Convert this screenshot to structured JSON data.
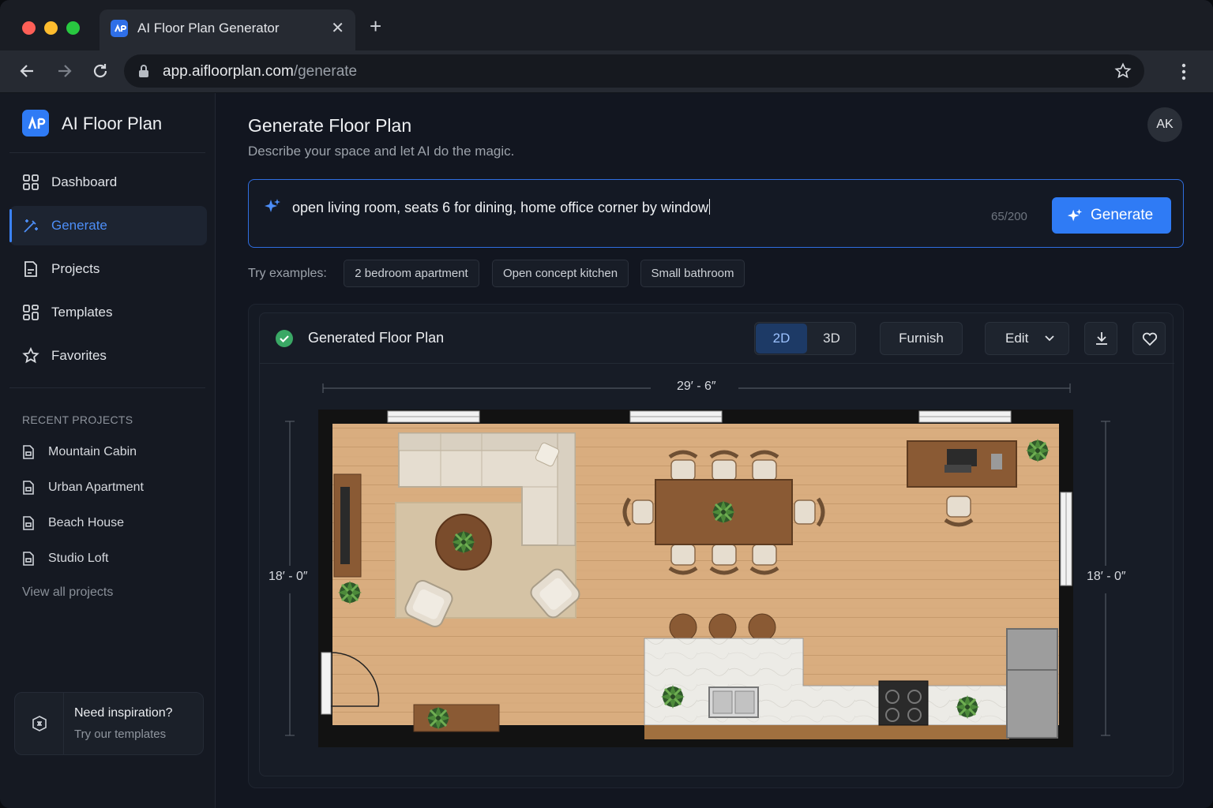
{
  "browser": {
    "tab_title": "AI Floor Plan Generator",
    "url_host": "app.aifloorplan.com",
    "url_path": "/generate"
  },
  "sidebar": {
    "brand": "AI Floor Plan",
    "nav": [
      {
        "label": "Dashboard",
        "icon": "grid-icon"
      },
      {
        "label": "Generate",
        "icon": "magic-wand-icon",
        "active": true
      },
      {
        "label": "Projects",
        "icon": "document-icon"
      },
      {
        "label": "Templates",
        "icon": "layout-icon"
      },
      {
        "label": "Favorites",
        "icon": "star-icon"
      }
    ],
    "recent_title": "RECENT PROJECTS",
    "recent": [
      "Mountain Cabin",
      "Urban Apartment",
      "Beach House",
      "Studio Loft"
    ],
    "view_all": "View all projects",
    "inspiration": {
      "title": "Need inspiration?",
      "subtitle": "Try our templates"
    }
  },
  "main": {
    "title": "Generate Floor Plan",
    "subtitle": "Describe your space and let AI do the magic.",
    "avatar": "AK",
    "prompt": {
      "value": "open living room, seats 6 for dining, home office corner by window",
      "counter": "65/200"
    },
    "generate_label": "Generate",
    "examples_label": "Try examples:",
    "examples": [
      "2 bedroom apartment",
      "Open concept kitchen",
      "Small bathroom"
    ],
    "result": {
      "title": "Generated Floor Plan",
      "view_2d": "2D",
      "view_3d": "3D",
      "active_view": "2D",
      "furnish": "Furnish",
      "edit": "Edit",
      "width_dim": "29′ - 6″",
      "height_left": "18′ - 0″",
      "height_right": "18′ - 0″"
    }
  },
  "colors": {
    "accent": "#2f7bf5",
    "success": "#3aa865",
    "floor": "#d7aa7b",
    "wall": "#111111"
  }
}
